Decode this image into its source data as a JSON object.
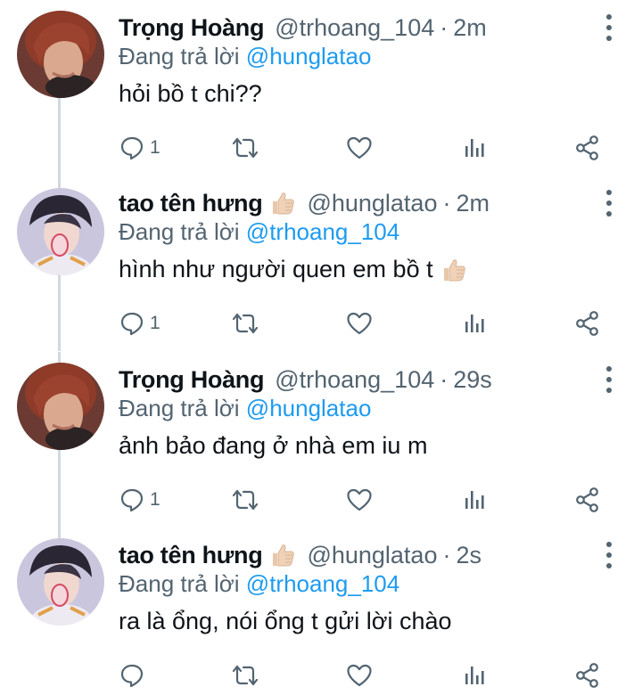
{
  "tweets": [
    {
      "name": "Trọng Hoàng",
      "has_emoji": false,
      "handle": "@trhoang_104",
      "separator": "·",
      "time": "2m",
      "reply_prefix": "Đang trả lời",
      "reply_to": "@hunglatao",
      "text": "hỏi bồ t chi??",
      "reply_count": "1",
      "avatar": "red-haired-person"
    },
    {
      "name": "tao tên hưng",
      "has_emoji": true,
      "handle": "@hunglatao",
      "separator": "·",
      "time": "2m",
      "reply_prefix": "Đang trả lời",
      "reply_to": "@trhoang_104",
      "text": "hình như người quen em bồ t",
      "reply_count": "1",
      "avatar": "dark-haired-person"
    },
    {
      "name": "Trọng Hoàng",
      "has_emoji": false,
      "handle": "@trhoang_104",
      "separator": "·",
      "time": "29s",
      "reply_prefix": "Đang trả lời",
      "reply_to": "@hunglatao",
      "text": "ảnh bảo đang ở nhà em iu m",
      "reply_count": "1",
      "avatar": "red-haired-person"
    },
    {
      "name": "tao tên hưng",
      "has_emoji": true,
      "handle": "@hunglatao",
      "separator": "·",
      "time": "2s",
      "reply_prefix": "Đang trả lời",
      "reply_to": "@trhoang_104",
      "text": "ra là ổng, nói ổng t gửi lời chào",
      "reply_count": "",
      "avatar": "dark-haired-person"
    }
  ],
  "emoji": "thumbs-up-light-skin-tone-icon",
  "colors": {
    "text": "#0f1419",
    "muted": "#536471",
    "link": "#1d9bf0",
    "thread_line": "#cfd9de"
  }
}
